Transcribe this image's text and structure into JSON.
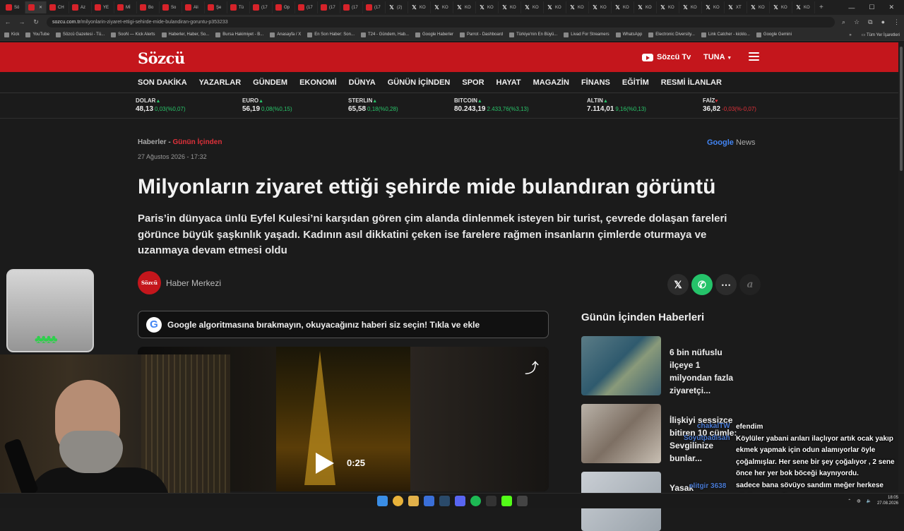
{
  "browser": {
    "tabs": [
      {
        "label": "Sö",
        "icon": "red",
        "active": false
      },
      {
        "label": "",
        "icon": "red",
        "active": true
      },
      {
        "label": "CH",
        "icon": "red"
      },
      {
        "label": "Az",
        "icon": "red"
      },
      {
        "label": "YE",
        "icon": "red"
      },
      {
        "label": "Mİ",
        "icon": "red"
      },
      {
        "label": "Bo",
        "icon": "red"
      },
      {
        "label": "So",
        "icon": "red"
      },
      {
        "label": "Ali",
        "icon": "red"
      },
      {
        "label": "Şe",
        "icon": "red"
      },
      {
        "label": "Tü",
        "icon": "red"
      },
      {
        "label": "(17",
        "icon": "red"
      },
      {
        "label": "Op",
        "icon": "red"
      },
      {
        "label": "(17",
        "icon": "red"
      },
      {
        "label": "(17",
        "icon": "red"
      },
      {
        "label": "(17",
        "icon": "red"
      },
      {
        "label": "(17",
        "icon": "red"
      },
      {
        "label": "(2)",
        "icon": "x"
      },
      {
        "label": "KO",
        "icon": "x"
      },
      {
        "label": "KO",
        "icon": "x"
      },
      {
        "label": "KO",
        "icon": "x"
      },
      {
        "label": "KO",
        "icon": "x"
      },
      {
        "label": "KO",
        "icon": "x"
      },
      {
        "label": "KO",
        "icon": "x"
      },
      {
        "label": "KO",
        "icon": "x"
      },
      {
        "label": "KO",
        "icon": "x"
      },
      {
        "label": "KO",
        "icon": "x"
      },
      {
        "label": "KO",
        "icon": "x"
      },
      {
        "label": "KO",
        "icon": "x"
      },
      {
        "label": "KO",
        "icon": "x"
      },
      {
        "label": "KO",
        "icon": "x"
      },
      {
        "label": "KO",
        "icon": "x"
      },
      {
        "label": "XT",
        "icon": "x"
      },
      {
        "label": "KO",
        "icon": "x"
      },
      {
        "label": "KO",
        "icon": "x"
      },
      {
        "label": "KO",
        "icon": "x"
      }
    ],
    "url_domain": "sozcu.com.tr",
    "url_path": "/milyonlarin-ziyaret-ettigi-sehirde-mide-bulandiran-goruntu-p353233",
    "bookmarks": [
      "Kick",
      "YouTube",
      "Sözcü Gazetesi - Tü...",
      "SooN — Kick Alerts",
      "Haberler, Haber, So...",
      "Bursa Hakimiyet - B...",
      "Anasayfa / X",
      "En Son Haber: Son...",
      "T24 - Gündem, Hab...",
      "Google Haberler",
      "Parrot - Dashboard",
      "Türkiye'nin En Büyü...",
      "Livad For Streamers",
      "WhatsApp",
      "Electronic Diversity...",
      "Link Catcher - kicklo...",
      "Google Gemini"
    ],
    "bookmarks_more": "»",
    "all_bookmarks": "Tüm Yer İşaretleri"
  },
  "site": {
    "logo": "Sözcü",
    "tv_label": "Sözcü Tv",
    "user_label": "TUNA",
    "nav": [
      "SON DAKİKA",
      "YAZARLAR",
      "GÜNDEM",
      "EKONOMİ",
      "DÜNYA",
      "GÜNÜN İÇİNDEN",
      "SPOR",
      "HAYAT",
      "MAGAZİN",
      "FİNANS",
      "EĞİTİM",
      "RESMİ İLANLAR"
    ],
    "markets": [
      {
        "name": "DOLAR",
        "dir": "up",
        "value": "48,13",
        "change": "0,03(%0,07)"
      },
      {
        "name": "EURO",
        "dir": "up",
        "value": "56,19",
        "change": "0,08(%0,15)"
      },
      {
        "name": "STERLIN",
        "dir": "up",
        "value": "65,58",
        "change": "0,18(%0,28)"
      },
      {
        "name": "BITCOIN",
        "dir": "up",
        "value": "80.243,19",
        "change": "2.433,76(%3,13)"
      },
      {
        "name": "ALTIN",
        "dir": "up",
        "value": "7.114,01",
        "change": "9,16(%0,13)"
      },
      {
        "name": "FAİZ",
        "dir": "down",
        "value": "36,82",
        "change": "-0,03(%-0,07)"
      }
    ]
  },
  "article": {
    "breadcrumb_root": "Haberler -",
    "breadcrumb_section": "Günün İçinden",
    "date": "27 Ağustos 2026 - 17:32",
    "google_news": "Google News",
    "headline": "Milyonların ziyaret ettiği şehirde mide bulandıran görüntü",
    "lead": "Paris’in dünyaca ünlü Eyfel Kulesi’ni karşıdan gören çim alanda dinlenmek isteyen bir turist, çevrede dolaşan fareleri görünce büyük şaşkınlık yaşadı. Kadının asıl dikkatini çeken ise farelere rağmen insanların çimlerde oturmaya ve uzanmaya devam etmesi oldu",
    "author_avatar": "Sözcü",
    "author": "Haber Merkezi",
    "share_x": "𝕏",
    "google_banner": "Google algoritmasına bırakmayın, okuyacağınız haberi siz seçin! Tıkla ve ekle",
    "video_duration": "0:25"
  },
  "sidebar": {
    "title": "Günün İçinden Haberleri",
    "items": [
      {
        "title": "6 bin nüfuslu ilçeye 1 milyondan fazla ziyaretçi..."
      },
      {
        "title": "İlişkiyi sessizce bitiren 10 cümle: Sevgilinize bunlar..."
      },
      {
        "title": "Yasak dinlemedi..."
      }
    ]
  },
  "stream_chat": {
    "names": [
      "chakalTW",
      "Soyutpadisah",
      "elitgir 3638"
    ],
    "messages": [
      "efendim",
      "Köylüler yabani arıları ilaçlıyor artık ocak yakıp ekmek yapmak için odun alamıyorlar öyle çoğalmışlar. Her sene bir şey çoğalıyor , 2 sene önce her yer bok böceği kaynıyordu.",
      "sadece bana sövüyo sandım meğer herkese sövüyormuş :D"
    ]
  },
  "taskbar": {
    "time": "18:05",
    "date": "27.08.2026"
  },
  "colors": {
    "brand": "#c4161c",
    "up": "#29c46a",
    "down": "#e0313a"
  }
}
